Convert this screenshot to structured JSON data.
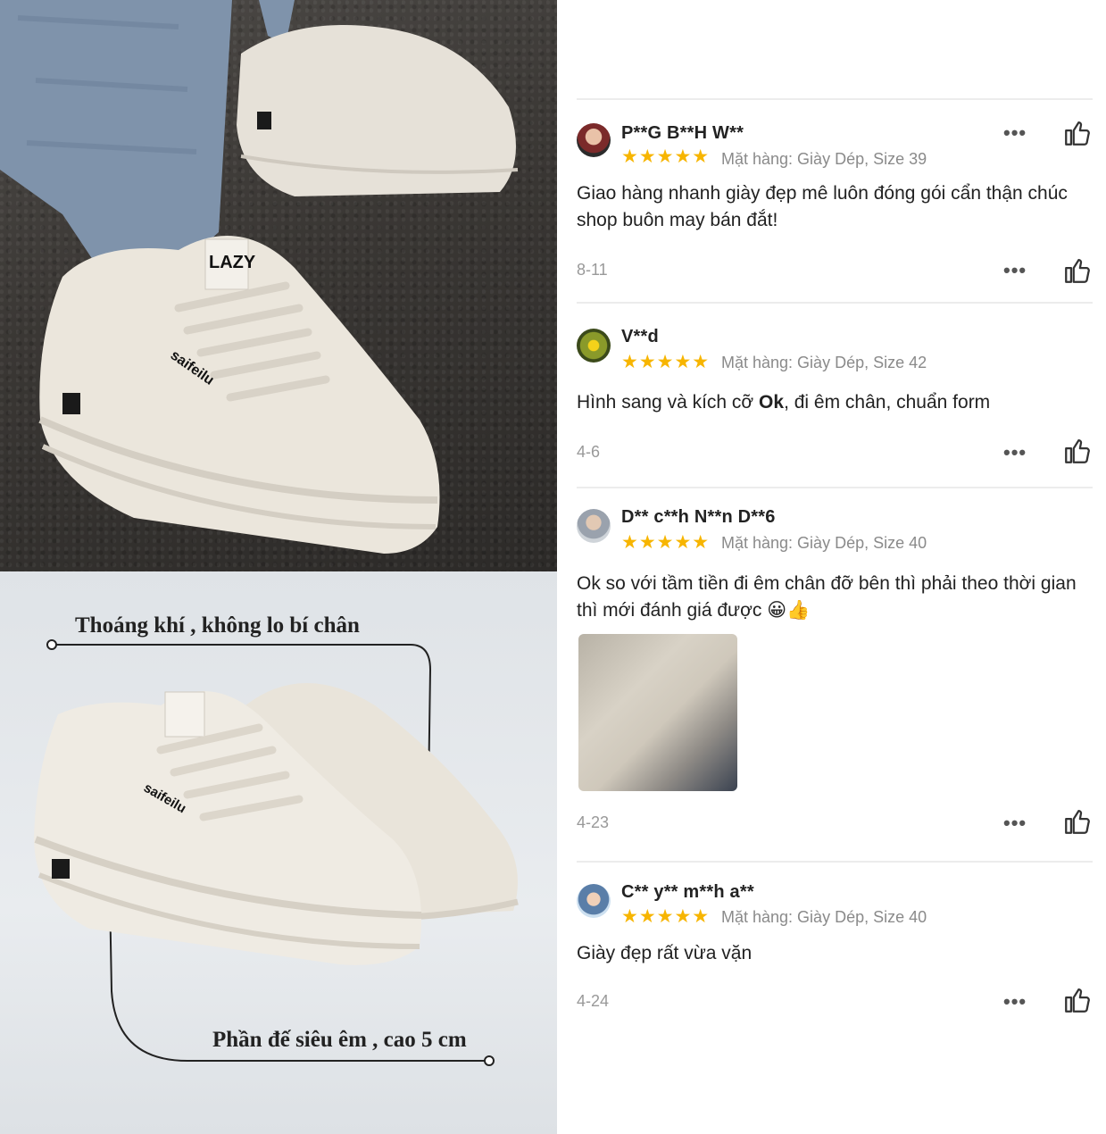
{
  "promo": {
    "callout_top": "Thoáng khí , không lo bí chân",
    "callout_bottom": "Phần đế siêu êm , cao 5 cm",
    "brand_print": "saifeilu",
    "tag_print": "LAZY"
  },
  "reviews": [
    {
      "username": "P**G B**H W**",
      "stars": "★★★★★",
      "rating": 5,
      "variant": "Mặt hàng: Giày Dép, Size 39",
      "text": "Giao hàng nhanh giày đẹp mê luôn đóng gói cẩn thận chúc shop buôn may bán đắt!",
      "date": "8-11"
    },
    {
      "username": "V**d",
      "stars": "★★★★★",
      "rating": 5,
      "variant": "Mặt hàng: Giày Dép, Size 42",
      "text_before": "Hình sang và kích cỡ ",
      "text_bold": "Ok",
      "text_after": ", đi êm chân, chuẩn form",
      "date": "4-6"
    },
    {
      "username": "D** c**h N**n D**6",
      "stars": "★★★★★",
      "rating": 5,
      "variant": "Mặt hàng: Giày Dép, Size 40",
      "text": "Ok so với tầm tiền đi êm chân đỡ bên thì phải theo thời gian thì mới đánh giá được 😀👍",
      "date": "4-23"
    },
    {
      "username": "C** y** m**h a**",
      "stars": "★★★★★",
      "rating": 5,
      "variant": "Mặt hàng: Giày Dép, Size 40",
      "text": "Giày đẹp rất vừa vặn",
      "date": "4-24"
    }
  ],
  "icons": {
    "more": "more-dots-icon",
    "like": "thumbs-up-icon"
  },
  "colors": {
    "star": "#f7b500",
    "divider": "#ececec",
    "muted": "#8a8a8a"
  }
}
